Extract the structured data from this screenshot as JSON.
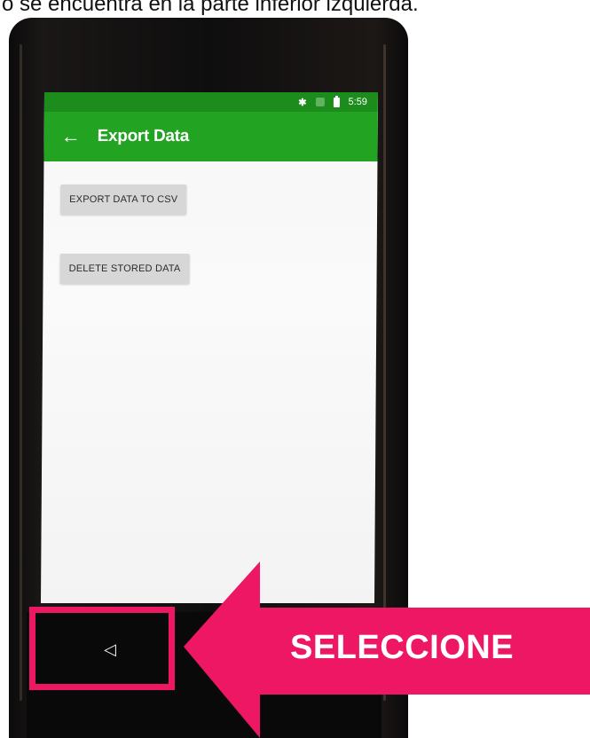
{
  "caption": {
    "text": "o se encuentra en la parte inferior izquierda."
  },
  "status_bar": {
    "bluetooth_icon": "bluetooth-icon",
    "signal_icon": "signal-icon",
    "battery_icon": "battery-icon",
    "time": "5:59"
  },
  "app_bar": {
    "back_icon": "arrow-left-icon",
    "title": "Export Data"
  },
  "buttons": {
    "export_label": "EXPORT DATA TO CSV",
    "delete_label": "DELETE STORED DATA"
  },
  "nav_bar": {
    "back_icon": "triangle-back-icon"
  },
  "annotation": {
    "label": "SELECCIONE",
    "color": "#ee1763"
  },
  "colors": {
    "status_bar": "#1c8c1c",
    "app_bar": "#22a322",
    "button_bg": "#d7d7d7",
    "screen_bg": "#f6f6f6"
  }
}
